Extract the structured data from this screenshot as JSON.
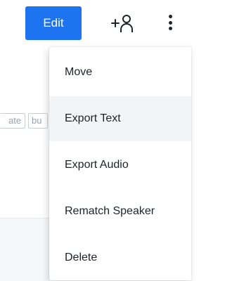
{
  "toolbar": {
    "edit_label": "Edit",
    "add_user_icon": "add-user-icon",
    "more_icon": "more-vertical-icon",
    "accent_color": "#1e73f0"
  },
  "background": {
    "tags": [
      "ate",
      "bu"
    ]
  },
  "menu": {
    "items": [
      {
        "label": "Move"
      },
      {
        "label": "Export Text"
      },
      {
        "label": "Export Audio"
      },
      {
        "label": "Rematch Speaker"
      },
      {
        "label": "Delete"
      }
    ],
    "hovered_item": "Export Text"
  }
}
